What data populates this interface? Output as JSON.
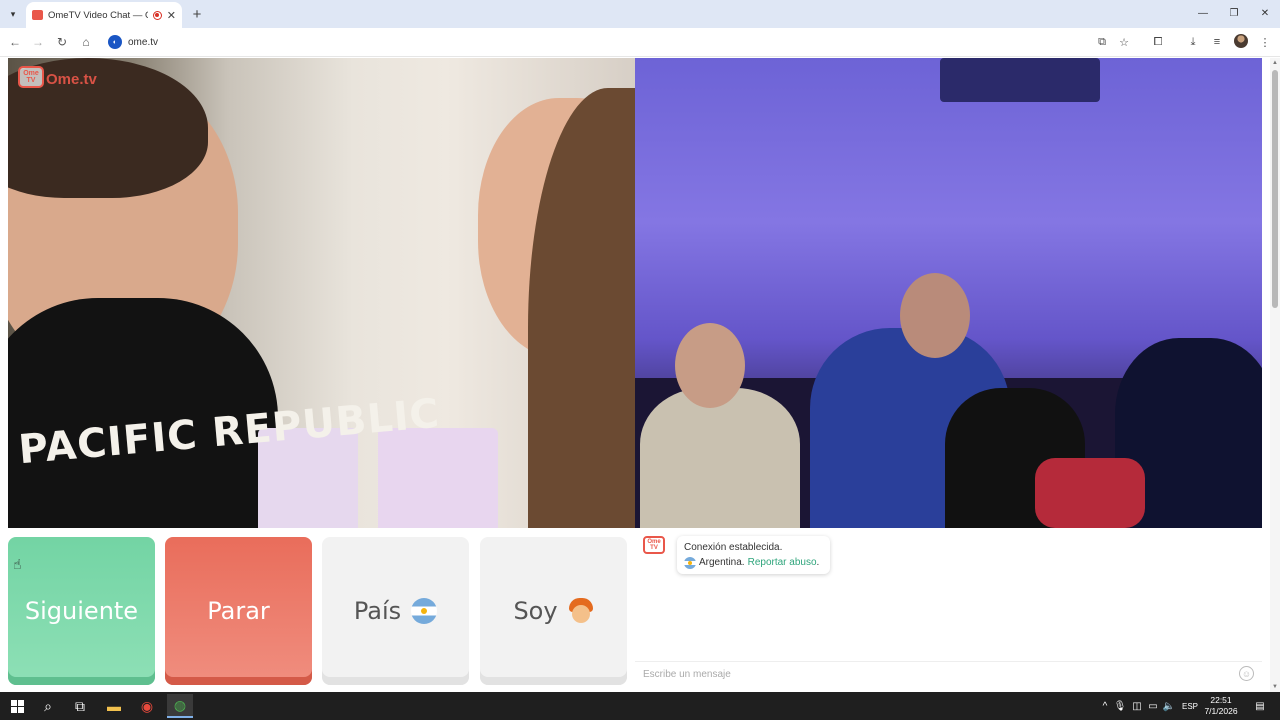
{
  "browser": {
    "tab_title": "OmeTV Video Chat — Ome",
    "url": "ome.tv"
  },
  "site": {
    "logo_badge": "Ome TV",
    "logo_text": "Ome.tv"
  },
  "video": {
    "shirt_text": "PACIFIC REPUBLIC"
  },
  "buttons": {
    "next": "Siguiente",
    "stop": "Parar",
    "country": "País",
    "soy": "Soy"
  },
  "chat": {
    "status": "Conexión establecida.",
    "country": "Argentina.",
    "report": "Reportar abuso",
    "report_suffix": ".",
    "input_placeholder": "Escribe un mensaje"
  },
  "taskbar": {
    "language": "ESP",
    "time": "22:51",
    "date": "7/1/2026"
  },
  "colors": {
    "next": "#73d4a4",
    "stop": "#e96d5b",
    "brand": "#e9574a",
    "link": "#2fa57c"
  }
}
